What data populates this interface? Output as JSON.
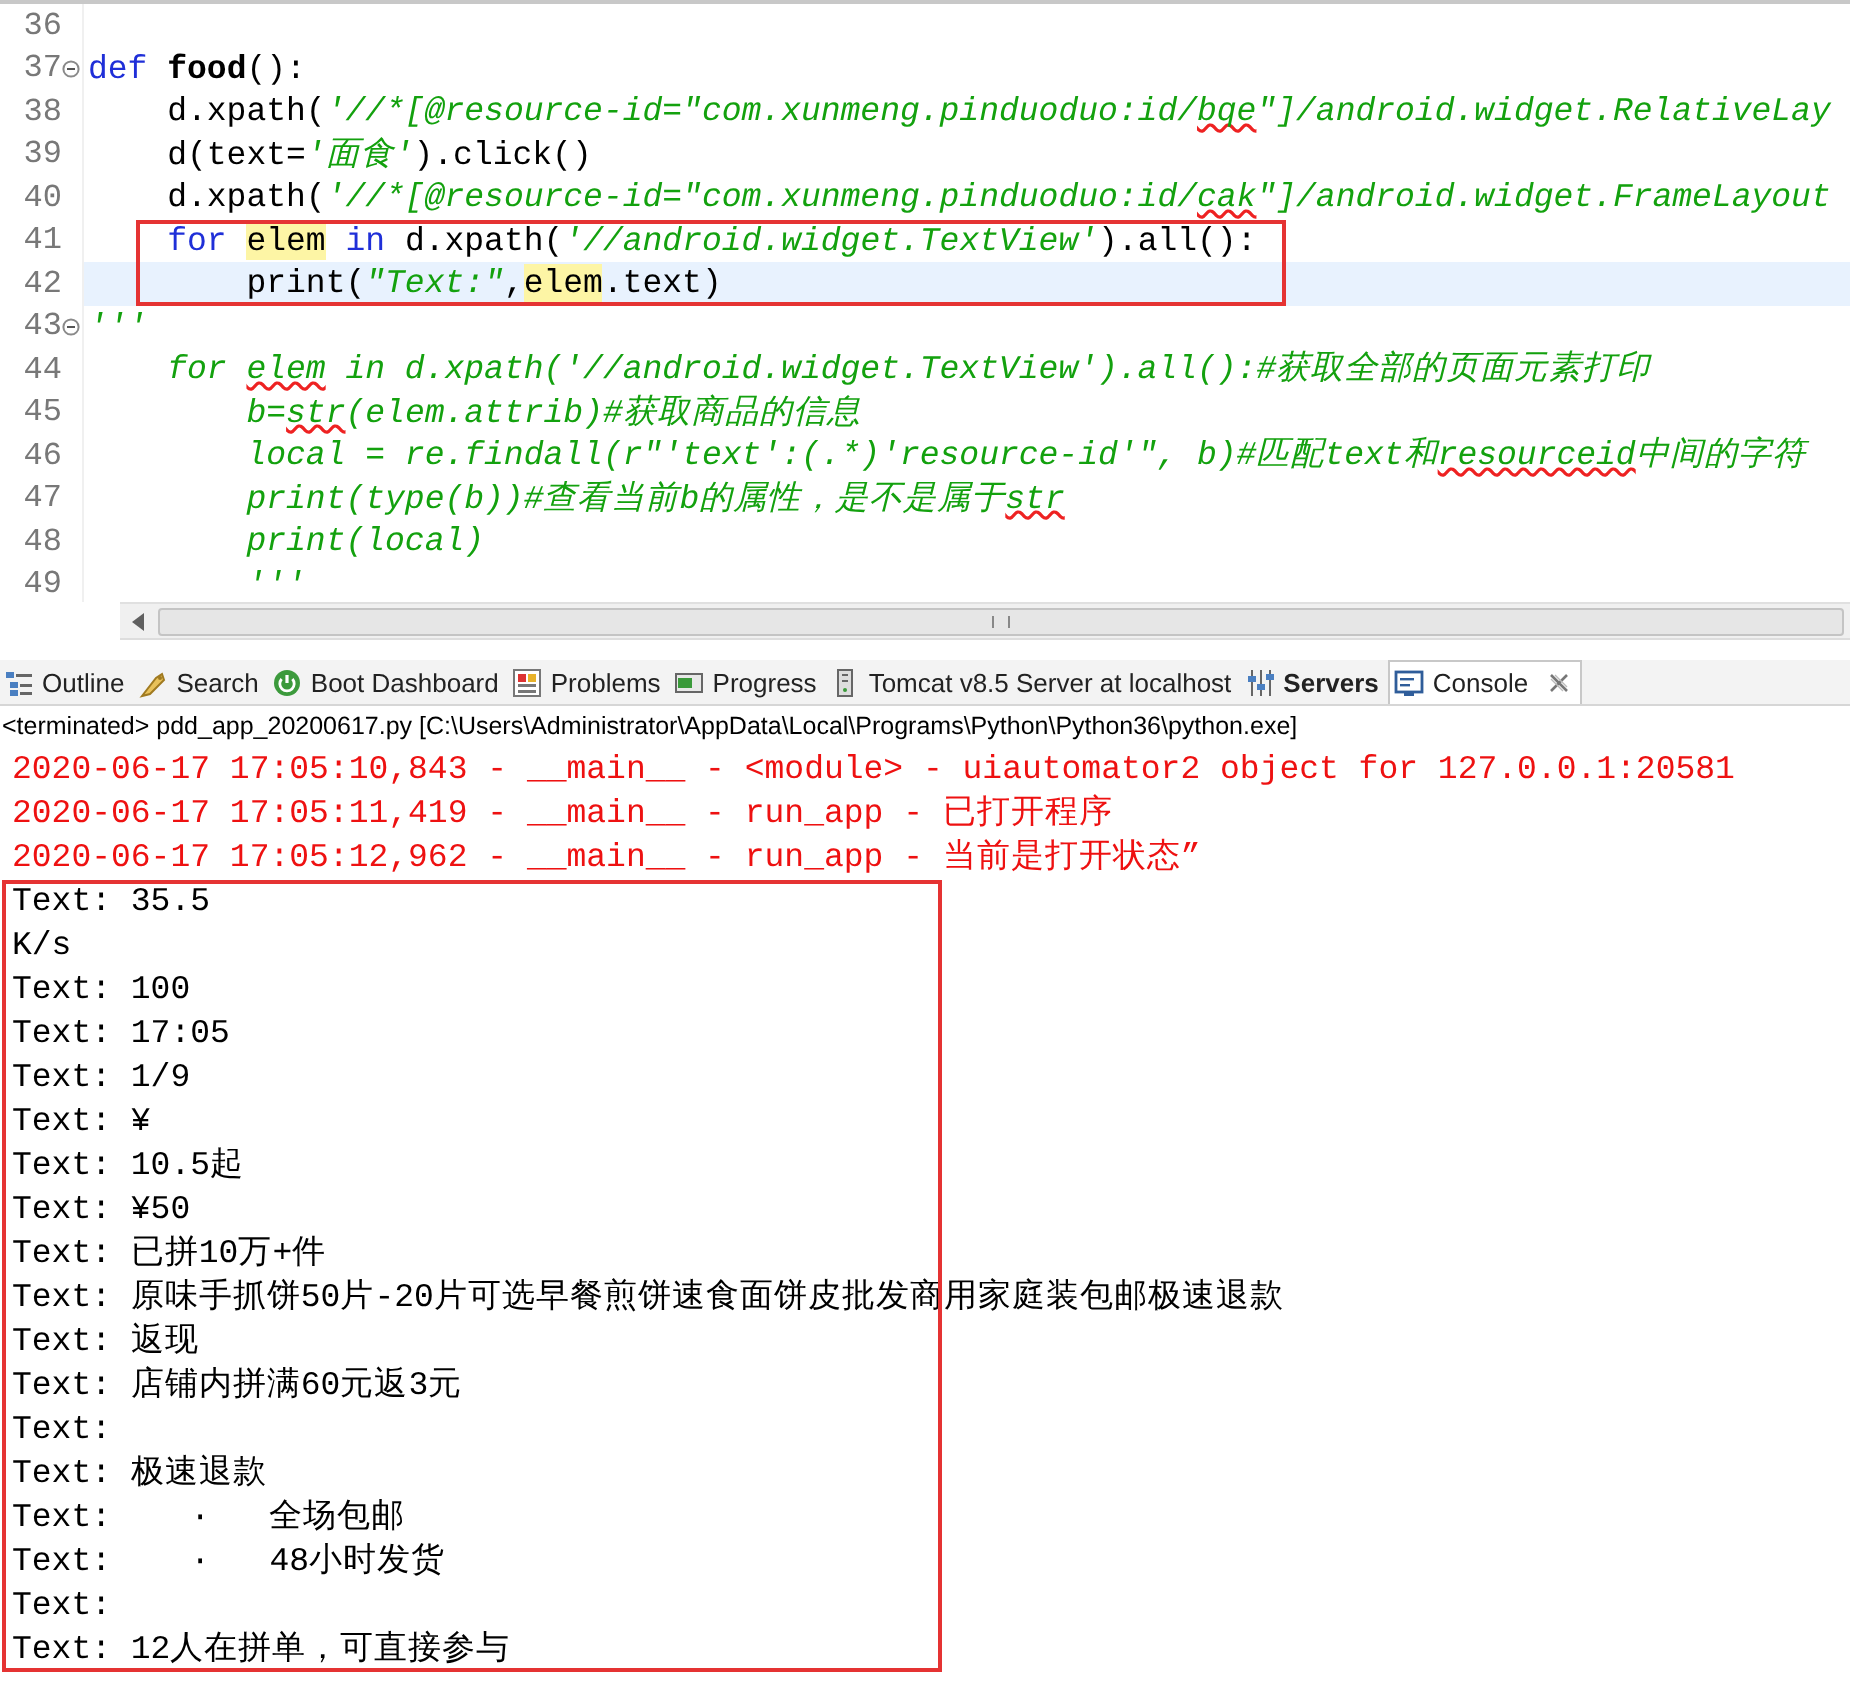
{
  "editor": {
    "lines": [
      {
        "number": "36",
        "fold": false,
        "current": false,
        "boxed": false
      },
      {
        "number": "37",
        "fold": true,
        "current": false,
        "boxed": false,
        "tokens": [
          {
            "kind": "kw",
            "text": "def"
          },
          {
            "kind": "fn",
            "text": " food"
          },
          {
            "kind": "plain",
            "text": "():"
          }
        ]
      },
      {
        "number": "38",
        "fold": false,
        "current": false,
        "boxed": false,
        "tokens": [
          {
            "kind": "plain",
            "text": "    d.xpath("
          },
          {
            "kind": "str",
            "text": "'//*[@resource-id=\"com.xunmeng.pinduoduo:id/"
          },
          {
            "kind": "str",
            "text": "bqe",
            "spell": true
          },
          {
            "kind": "str",
            "text": "\"]/android.widget.RelativeLay"
          }
        ]
      },
      {
        "number": "39",
        "fold": false,
        "current": false,
        "boxed": false,
        "tokens": [
          {
            "kind": "plain",
            "text": "    d(text="
          },
          {
            "kind": "str",
            "text": "'面食'"
          },
          {
            "kind": "plain",
            "text": ").click()"
          }
        ]
      },
      {
        "number": "40",
        "fold": false,
        "current": false,
        "boxed": false,
        "tokens": [
          {
            "kind": "plain",
            "text": "    d.xpath("
          },
          {
            "kind": "str",
            "text": "'//*[@resource-id=\"com.xunmeng.pinduoduo:id/"
          },
          {
            "kind": "str",
            "text": "cak",
            "spell": true
          },
          {
            "kind": "str",
            "text": "\"]/android.widget.FrameLayout"
          }
        ]
      },
      {
        "number": "41",
        "fold": false,
        "current": false,
        "boxed": true,
        "tokens": [
          {
            "kind": "kw",
            "text": "    for "
          },
          {
            "kind": "occ",
            "text": "elem"
          },
          {
            "kind": "kw",
            "text": " in"
          },
          {
            "kind": "plain",
            "text": " d.xpath("
          },
          {
            "kind": "str",
            "text": "'//android.widget.TextView'"
          },
          {
            "kind": "plain",
            "text": ").all():"
          }
        ]
      },
      {
        "number": "42",
        "fold": false,
        "current": true,
        "boxed": true,
        "tokens": [
          {
            "kind": "plain",
            "text": "        print("
          },
          {
            "kind": "str",
            "text": "\"Text:\""
          },
          {
            "kind": "plain",
            "text": ","
          },
          {
            "kind": "occ",
            "text": "elem"
          },
          {
            "kind": "plain",
            "text": ".text)"
          }
        ]
      },
      {
        "number": "43",
        "fold": true,
        "current": false,
        "boxed": false,
        "tokens": [
          {
            "kind": "str",
            "text": "'''"
          }
        ]
      },
      {
        "number": "44",
        "fold": false,
        "current": false,
        "boxed": false,
        "tokens": [
          {
            "kind": "str",
            "text": "    for "
          },
          {
            "kind": "str",
            "text": "elem",
            "spell": true
          },
          {
            "kind": "str",
            "text": " in d.xpath('//android.widget.TextView').all():#获取全部的页面元素打印"
          }
        ]
      },
      {
        "number": "45",
        "fold": false,
        "current": false,
        "boxed": false,
        "tokens": [
          {
            "kind": "str",
            "text": "        b="
          },
          {
            "kind": "str",
            "text": "str",
            "spell": true
          },
          {
            "kind": "str",
            "text": "(elem.attrib)#获取商品的信息"
          }
        ]
      },
      {
        "number": "46",
        "fold": false,
        "current": false,
        "boxed": false,
        "tokens": [
          {
            "kind": "str",
            "text": "        local = re.findall(r\"'text':(.*)'resource-id'\", b)#匹配text和"
          },
          {
            "kind": "str",
            "text": "resourceid",
            "spell": true
          },
          {
            "kind": "str",
            "text": "中间的字符"
          }
        ]
      },
      {
        "number": "47",
        "fold": false,
        "current": false,
        "boxed": false,
        "tokens": [
          {
            "kind": "str",
            "text": "        print(type(b))#查看当前b的属性，是不是属于"
          },
          {
            "kind": "str",
            "text": "str",
            "spell": true
          }
        ]
      },
      {
        "number": "48",
        "fold": false,
        "current": false,
        "boxed": false,
        "tokens": [
          {
            "kind": "str",
            "text": "        print(local)"
          }
        ]
      },
      {
        "number": "49",
        "fold": false,
        "current": false,
        "boxed": false,
        "tokens": [
          {
            "kind": "str",
            "text": "        '''"
          }
        ]
      }
    ]
  },
  "tabs": [
    {
      "kind": "outline",
      "label": "Outline",
      "selected": false,
      "bold": false
    },
    {
      "kind": "search",
      "label": "Search",
      "selected": false,
      "bold": false
    },
    {
      "kind": "boot",
      "label": "Boot Dashboard",
      "selected": false,
      "bold": false
    },
    {
      "kind": "problems",
      "label": "Problems",
      "selected": false,
      "bold": false
    },
    {
      "kind": "progress",
      "label": "Progress",
      "selected": false,
      "bold": false
    },
    {
      "kind": "server",
      "label": "Tomcat v8.5 Server at localhost",
      "selected": false,
      "bold": false
    },
    {
      "kind": "servers",
      "label": "Servers",
      "selected": false,
      "bold": true
    },
    {
      "kind": "console",
      "label": "Console",
      "selected": true,
      "bold": false
    }
  ],
  "console": {
    "header": "<terminated> pdd_app_20200617.py [C:\\Users\\Administrator\\AppData\\Local\\Programs\\Python\\Python36\\python.exe]",
    "lines": [
      {
        "kind": "stderr",
        "boxed": false,
        "text": "2020-06-17 17:05:10,843 - __main__ - <module> - uiautomator2 object for 127.0.0.1:20581"
      },
      {
        "kind": "stderr",
        "boxed": false,
        "text": "2020-06-17 17:05:11,419 - __main__ - run_app - 已打开程序"
      },
      {
        "kind": "stderr",
        "boxed": false,
        "text": "2020-06-17 17:05:12,962 - __main__ - run_app - 当前是打开状态”"
      },
      {
        "kind": "stdout",
        "boxed": true,
        "text": "Text: 35.5"
      },
      {
        "kind": "stdout",
        "boxed": true,
        "text": "K/s"
      },
      {
        "kind": "stdout",
        "boxed": true,
        "text": "Text: 100"
      },
      {
        "kind": "stdout",
        "boxed": true,
        "text": "Text: 17:05"
      },
      {
        "kind": "stdout",
        "boxed": true,
        "text": "Text: 1/9"
      },
      {
        "kind": "stdout",
        "boxed": true,
        "text": "Text: ¥"
      },
      {
        "kind": "stdout",
        "boxed": true,
        "text": "Text: 10.5起"
      },
      {
        "kind": "stdout",
        "boxed": true,
        "text": "Text: ¥50"
      },
      {
        "kind": "stdout",
        "boxed": true,
        "text": "Text: 已拼10万+件"
      },
      {
        "kind": "stdout",
        "boxed": true,
        "text": "Text: 原味手抓饼50片-20片可选早餐煎饼速食面饼皮批发商用家庭装包邮极速退款"
      },
      {
        "kind": "stdout",
        "boxed": true,
        "text": "Text: 返现"
      },
      {
        "kind": "stdout",
        "boxed": true,
        "text": "Text: 店铺内拼满60元返3元"
      },
      {
        "kind": "stdout",
        "boxed": true,
        "text": "Text:"
      },
      {
        "kind": "stdout",
        "boxed": true,
        "text": "Text: 极速退款"
      },
      {
        "kind": "stdout",
        "boxed": true,
        "text": "Text:    ·   全场包邮"
      },
      {
        "kind": "stdout",
        "boxed": true,
        "text": "Text:    ·   48小时发货"
      },
      {
        "kind": "stdout",
        "boxed": true,
        "text": "Text:"
      },
      {
        "kind": "stdout",
        "boxed": true,
        "text": "Text: 12人在拼单，可直接参与"
      }
    ]
  }
}
